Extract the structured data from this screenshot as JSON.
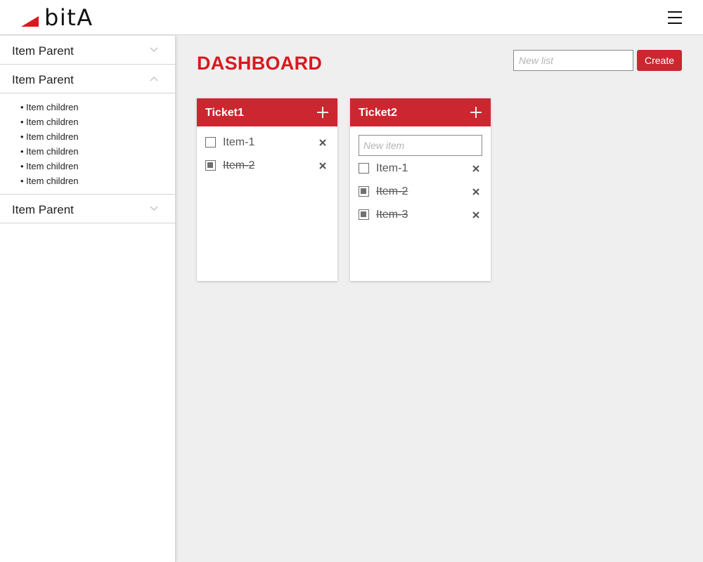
{
  "header": {
    "brand": "bitA",
    "brand_color": "#d9191f",
    "menu_icon": "hamburger-menu-icon"
  },
  "sidebar": {
    "sections": [
      {
        "label": "Item Parent",
        "expanded": false,
        "chevron": "chevron-down-icon"
      },
      {
        "label": "Item Parent",
        "expanded": true,
        "chevron": "chevron-up-icon",
        "children": [
          "• Item children",
          "• Item children",
          "• Item children",
          "• Item children",
          "• Item children",
          "• Item children"
        ]
      },
      {
        "label": "Item Parent",
        "expanded": false,
        "chevron": "chevron-down-icon"
      }
    ]
  },
  "main": {
    "title": "DASHBOARD",
    "new_list_placeholder": "New list",
    "create_label": "Create",
    "accent_color": "#cc2630"
  },
  "tickets": [
    {
      "title": "Ticket1",
      "show_input": false,
      "items": [
        {
          "label": "Item-1",
          "checked": false
        },
        {
          "label": "Item-2",
          "checked": true
        }
      ]
    },
    {
      "title": "Ticket2",
      "show_input": true,
      "input_placeholder": "New item",
      "items": [
        {
          "label": "Item-1",
          "checked": false
        },
        {
          "label": "Item-2",
          "checked": true
        },
        {
          "label": "Item-3",
          "checked": true
        }
      ]
    }
  ]
}
